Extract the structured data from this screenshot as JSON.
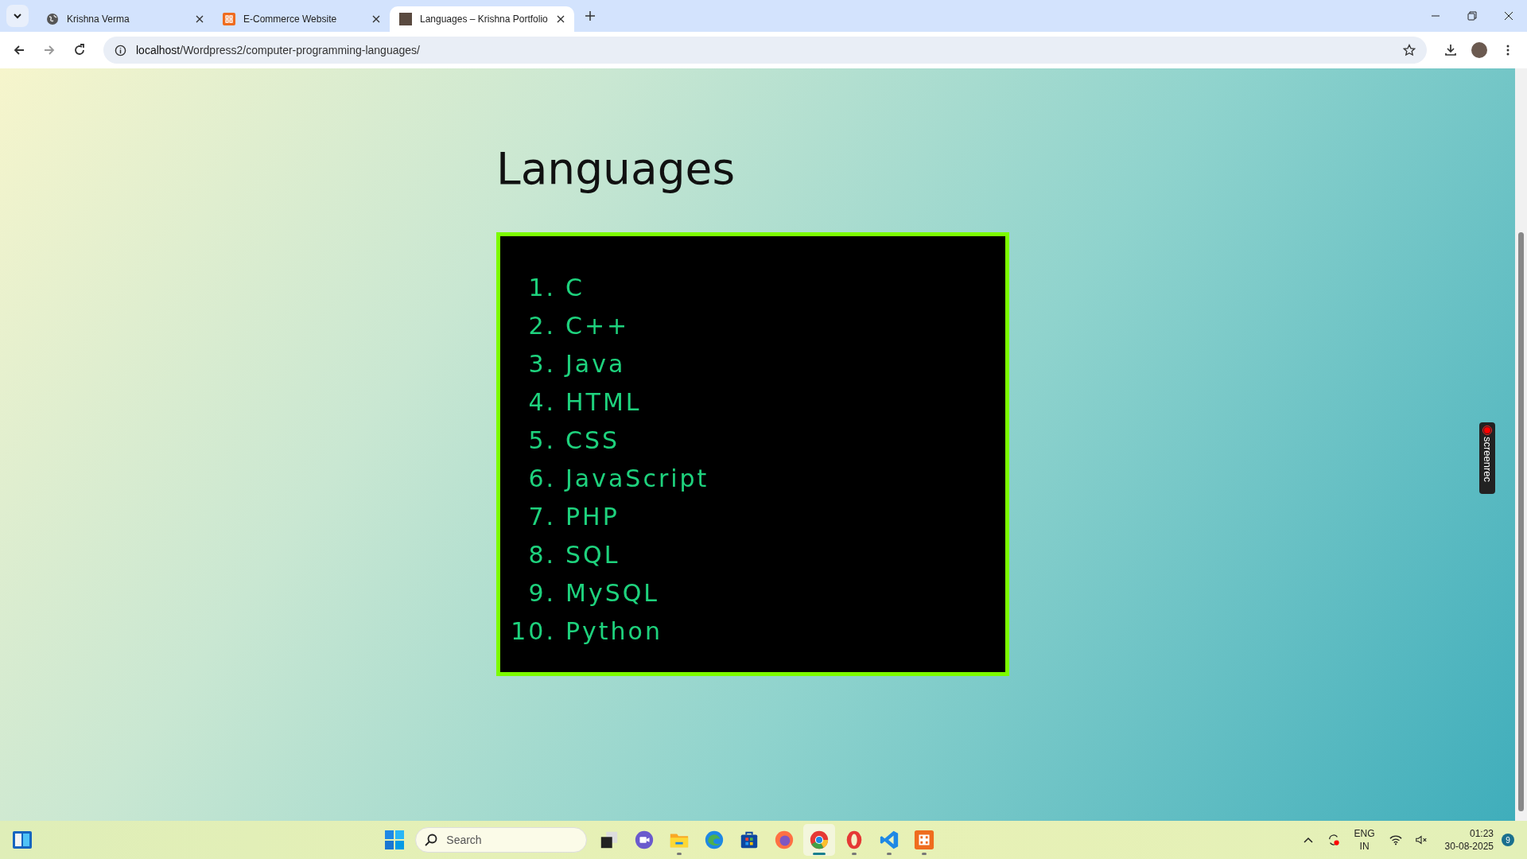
{
  "tabs": [
    {
      "title": "Krishna Verma",
      "kind": "globe",
      "selected": false
    },
    {
      "title": "E-Commerce Website",
      "kind": "xampp",
      "selected": false
    },
    {
      "title": "Languages – Krishna Portfolio",
      "kind": "photo",
      "selected": true
    }
  ],
  "address_bar": {
    "host": "localhost",
    "path": "/Wordpress2/computer-programming-languages/"
  },
  "page": {
    "heading": "Languages",
    "languages": [
      {
        "number": "1.",
        "name": "C"
      },
      {
        "number": "2.",
        "name": "C++"
      },
      {
        "number": "3.",
        "name": "Java"
      },
      {
        "number": "4.",
        "name": "HTML"
      },
      {
        "number": "5.",
        "name": "CSS"
      },
      {
        "number": "6.",
        "name": "JavaScript"
      },
      {
        "number": "7.",
        "name": "PHP"
      },
      {
        "number": "8.",
        "name": "SQL"
      },
      {
        "number": "9.",
        "name": "MySQL"
      },
      {
        "number": "10.",
        "name": "Python"
      }
    ]
  },
  "recorder_widget": {
    "label": "screenrec"
  },
  "taskbar": {
    "search_placeholder": "Search",
    "apps": [
      {
        "kind": "taskview",
        "running": false,
        "selected": false
      },
      {
        "kind": "meet",
        "running": false,
        "selected": false
      },
      {
        "kind": "explorer",
        "running": true,
        "selected": false
      },
      {
        "kind": "edge",
        "running": false,
        "selected": false
      },
      {
        "kind": "store",
        "running": false,
        "selected": false
      },
      {
        "kind": "firefox",
        "running": false,
        "selected": false
      },
      {
        "kind": "chrome",
        "running": true,
        "selected": true
      },
      {
        "kind": "opera",
        "running": true,
        "selected": false
      },
      {
        "kind": "vscode",
        "running": true,
        "selected": false
      },
      {
        "kind": "xampp",
        "running": true,
        "selected": false
      }
    ],
    "language": "ENG",
    "region": "IN",
    "time": "01:23",
    "date": "30-08-2025",
    "notification_count": "9"
  }
}
